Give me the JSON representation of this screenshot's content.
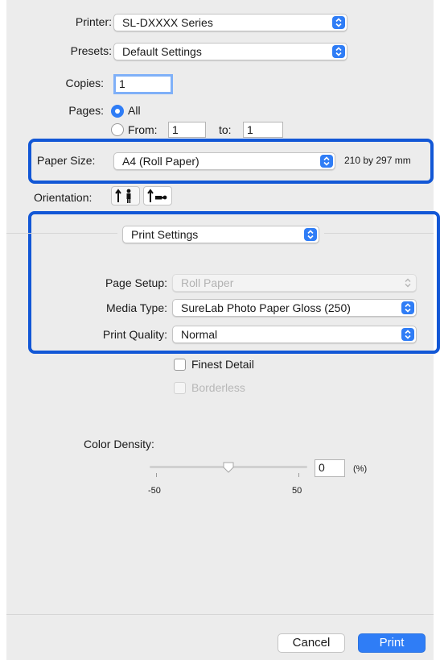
{
  "printer": {
    "label": "Printer:",
    "value": "SL-DXXXX Series"
  },
  "presets": {
    "label": "Presets:",
    "value": "Default Settings"
  },
  "copies": {
    "label": "Copies:",
    "value": "1"
  },
  "pages": {
    "label": "Pages:",
    "all_label": "All",
    "from_label": "From:",
    "from_value": "1",
    "to_label": "to:",
    "to_value": "1",
    "selected": "All"
  },
  "paper_size": {
    "label": "Paper Size:",
    "value": "A4 (Roll Paper)",
    "dimensions": "210 by 297 mm"
  },
  "orientation": {
    "label": "Orientation:",
    "selected": "portrait"
  },
  "section": {
    "value": "Print Settings"
  },
  "print_settings": {
    "page_setup": {
      "label": "Page Setup:",
      "value": "Roll Paper",
      "disabled": true
    },
    "media_type": {
      "label": "Media Type:",
      "value": "SureLab Photo Paper Gloss (250)"
    },
    "print_quality": {
      "label": "Print Quality:",
      "value": "Normal"
    },
    "finest_detail": {
      "label": "Finest Detail",
      "checked": false
    },
    "borderless": {
      "label": "Borderless",
      "checked": false,
      "disabled": true
    }
  },
  "color_density": {
    "label": "Color Density:",
    "value": "0",
    "unit": "(%)",
    "min_label": "-50",
    "max_label": "50",
    "min": -50,
    "max": 50
  },
  "buttons": {
    "cancel": "Cancel",
    "print": "Print"
  },
  "colors": {
    "accent": "#2f7df6",
    "highlight": "#1257d6",
    "panel": "#ececec"
  }
}
